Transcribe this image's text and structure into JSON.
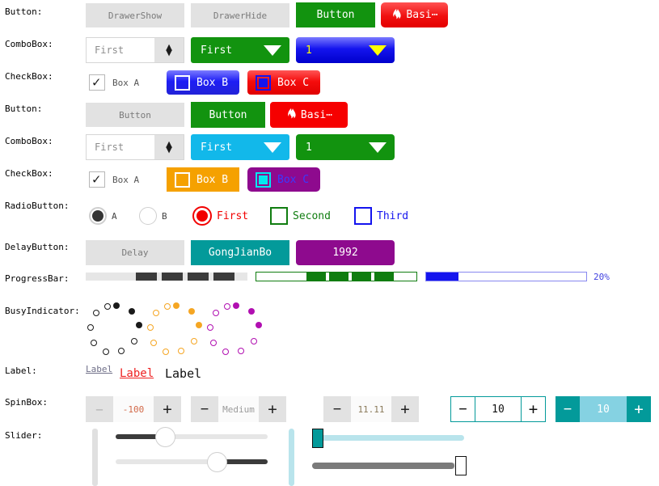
{
  "rows": [
    {
      "label": "Button:"
    },
    {
      "label": "ComboBox:"
    },
    {
      "label": "CheckBox:"
    },
    {
      "label": "Button:"
    },
    {
      "label": "ComboBox:"
    },
    {
      "label": "CheckBox:"
    },
    {
      "label": "RadioButton:"
    },
    {
      "label": "DelayButton:"
    },
    {
      "label": "ProgressBar:"
    },
    {
      "label": "BusyIndicator:"
    },
    {
      "label": "Label:"
    },
    {
      "label": "SpinBox:"
    },
    {
      "label": "Slider:"
    }
  ],
  "buttons_row1": [
    {
      "text": "DrawerShow",
      "style": "flat"
    },
    {
      "text": "DrawerHide",
      "style": "flat"
    },
    {
      "text": "Button",
      "style": "green"
    },
    {
      "text": "Basi⋯",
      "style": "red-grad",
      "icon": "flame-icon"
    }
  ],
  "buttons_row2": [
    {
      "text": "Button",
      "style": "flat"
    },
    {
      "text": "Button",
      "style": "green"
    },
    {
      "text": "Basi⋯",
      "style": "red-flat",
      "icon": "flame-icon"
    }
  ],
  "combos_row1": [
    {
      "value": "First",
      "style": "plain",
      "indicator": "updown-chevrons-icon"
    },
    {
      "value": "First",
      "style": "green",
      "indicator": "triangle-down-icon"
    },
    {
      "value": "1",
      "style": "blue-grad",
      "indicator": "triangle-down-icon"
    }
  ],
  "combos_row2": [
    {
      "value": "First",
      "style": "plain",
      "indicator": "updown-chevrons-icon"
    },
    {
      "value": "First",
      "style": "cyan",
      "indicator": "triangle-down-icon"
    },
    {
      "value": "1",
      "style": "green",
      "indicator": "triangle-down-icon"
    }
  ],
  "checkboxes_row1": [
    {
      "text": "Box A",
      "state": "checked",
      "style": "plain"
    },
    {
      "text": "Box B",
      "state": "unchecked",
      "style": "blue-grad"
    },
    {
      "text": "Box C",
      "state": "partial",
      "style": "red-grad"
    }
  ],
  "checkboxes_row2": [
    {
      "text": "Box A",
      "state": "checked",
      "style": "plain"
    },
    {
      "text": "Box B",
      "state": "unchecked",
      "style": "orange"
    },
    {
      "text": "Box C",
      "state": "partial",
      "style": "purple"
    }
  ],
  "radios": [
    {
      "text": "A",
      "state": "selected",
      "style": "dark-circle"
    },
    {
      "text": "B",
      "state": "unselected",
      "style": "light-circle"
    },
    {
      "text": "First",
      "state": "selected",
      "style": "red-circle"
    },
    {
      "text": "Second",
      "state": "unselected",
      "style": "green-square"
    },
    {
      "text": "Third",
      "state": "unselected",
      "style": "blue-square"
    }
  ],
  "delay_buttons": [
    {
      "text": "Delay",
      "style": "flat"
    },
    {
      "text": "GongJianBo",
      "style": "teal"
    },
    {
      "text": "1992",
      "style": "purple"
    }
  ],
  "progress_bars": [
    {
      "style": "gray-indeterminate",
      "value": null,
      "value_text": ""
    },
    {
      "style": "green-indeterminate",
      "value": null,
      "value_text": ""
    },
    {
      "style": "blue-determinate",
      "value": 20,
      "value_text": "20%"
    }
  ],
  "busy_indicators": [
    {
      "color": "#1a1a1a",
      "dots": 10
    },
    {
      "color": "#f5a623",
      "dots": 10
    },
    {
      "color": "#b10fb1",
      "dots": 10
    }
  ],
  "labels": [
    {
      "text": "Label",
      "style": "small-gray-underline"
    },
    {
      "text": "Label",
      "style": "red-underline"
    },
    {
      "text": "Label",
      "style": "black-plain"
    }
  ],
  "spinboxes": [
    {
      "value": "-100",
      "style": "flat",
      "minus": "−",
      "plus": "+"
    },
    {
      "value": "Medium",
      "style": "flat",
      "minus": "−",
      "plus": "+"
    },
    {
      "value": "11.11",
      "style": "flat",
      "minus": "−",
      "plus": "+"
    },
    {
      "value": "10",
      "style": "teal-outline",
      "minus": "−",
      "plus": "+"
    },
    {
      "value": "10",
      "style": "teal-filled",
      "minus": "−",
      "plus": "+"
    }
  ],
  "sliders": [
    {
      "orientation": "vertical",
      "style": "gray",
      "value": 0
    },
    {
      "orientation": "horizontal",
      "style": "dark-round-handle",
      "value": 37
    },
    {
      "orientation": "horizontal",
      "style": "dark-round-handle",
      "value": 72
    },
    {
      "orientation": "vertical",
      "style": "light-blue",
      "value": 0
    },
    {
      "orientation": "horizontal",
      "style": "teal-square-handle",
      "value": 2
    },
    {
      "orientation": "horizontal",
      "style": "gray-white-handle",
      "value": 93
    }
  ],
  "colors": {
    "flat_bg": "#e2e2e2",
    "green": "#12930f",
    "red": "#f60000",
    "teal": "#039a9a",
    "purple": "#8e0a8e",
    "orange": "#f5a100",
    "cyan": "#12b8ea",
    "blue": "#1414ee",
    "light_blue": "#b9e4ec"
  }
}
